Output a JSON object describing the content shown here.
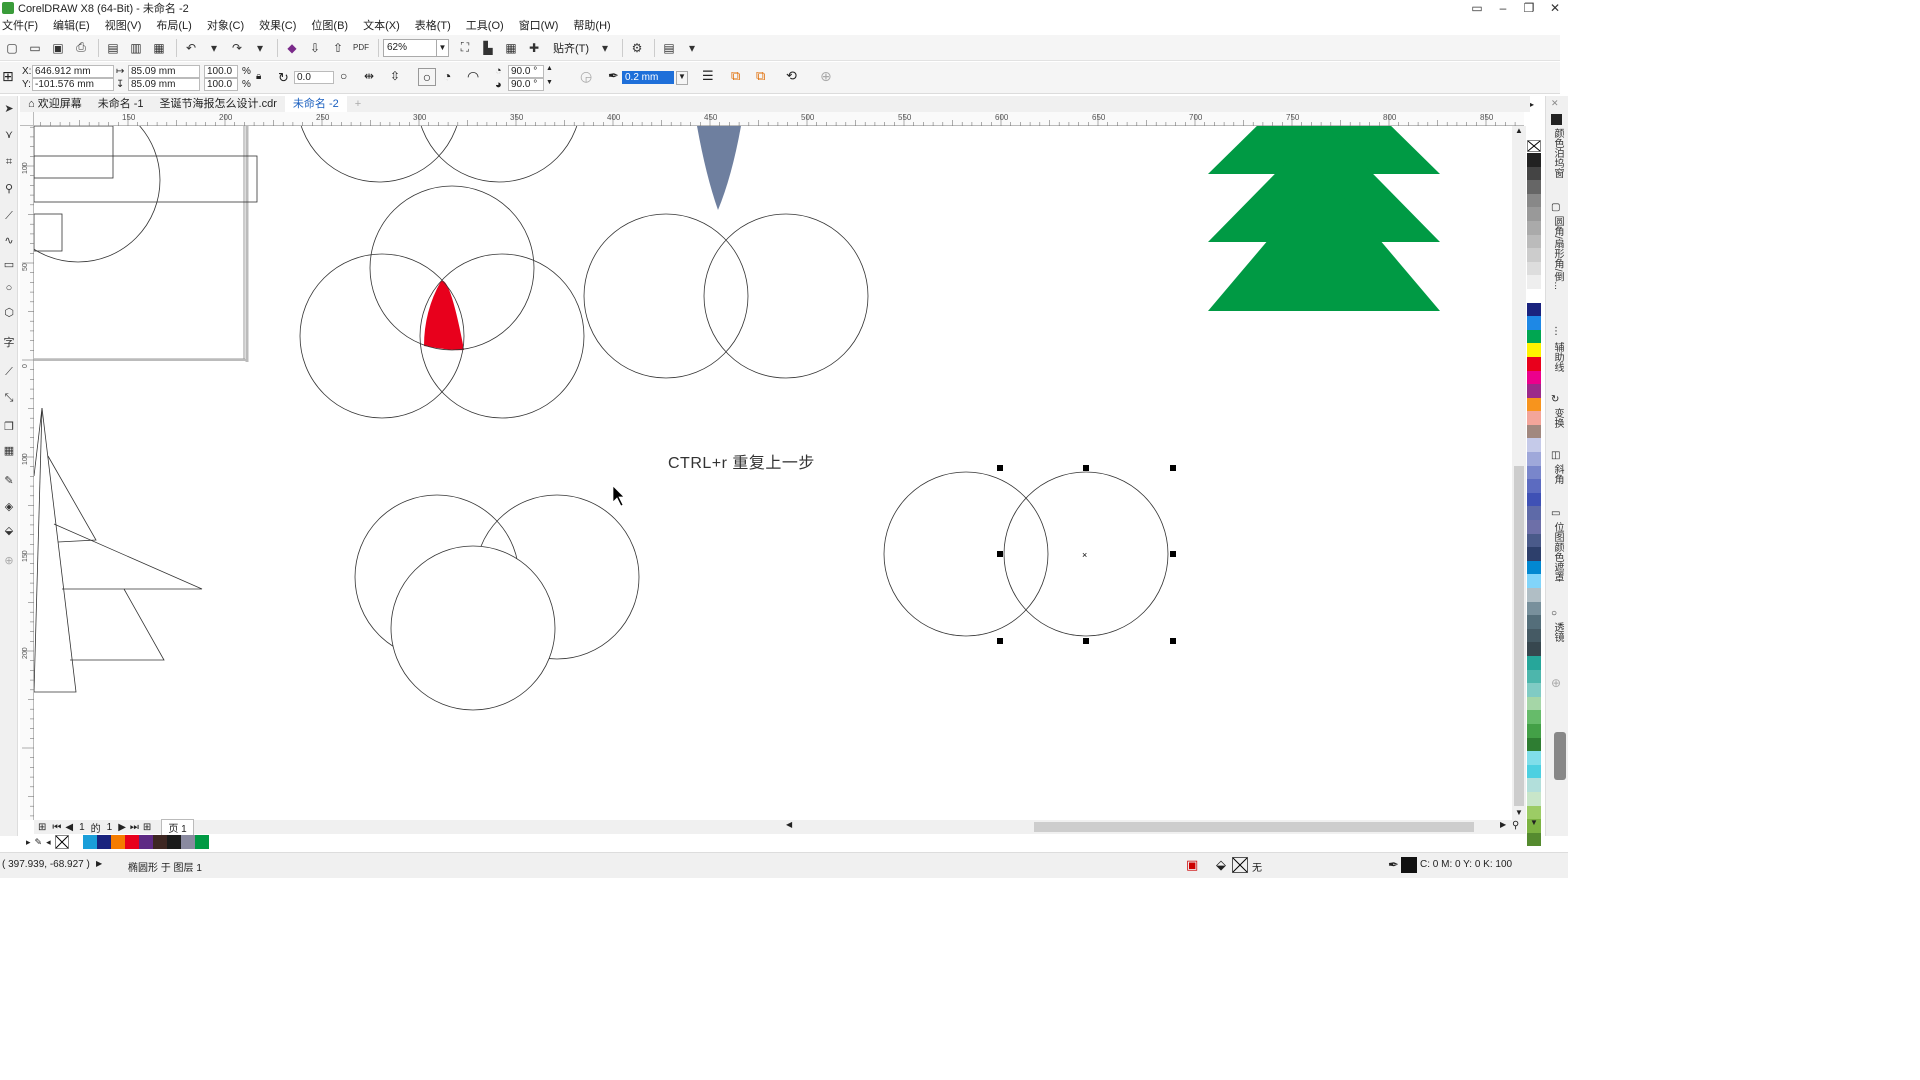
{
  "window": {
    "title": "CorelDRAW X8 (64-Bit) - 未命名 -2",
    "controls": [
      "▭",
      "–",
      "❐",
      "✕"
    ]
  },
  "menu": [
    "文件(F)",
    "编辑(E)",
    "视图(V)",
    "布局(L)",
    "对象(C)",
    "效果(C)",
    "位图(B)",
    "文本(X)",
    "表格(T)",
    "工具(O)",
    "窗口(W)",
    "帮助(H)"
  ],
  "toolbar": {
    "zoom": "62%",
    "snap": "贴齐(T)"
  },
  "propbar": {
    "x_label": "X:",
    "y_label": "Y:",
    "x": "646.912 mm",
    "y": "-101.576 mm",
    "w": "85.09 mm",
    "h": "85.09 mm",
    "sx": "100.0",
    "sy": "100.0",
    "pct": "%",
    "rotate": "0.0",
    "angle1": "90.0 °",
    "angle2": "90.0 °",
    "outline": "0.2 mm"
  },
  "tabs": [
    {
      "label": "欢迎屏幕",
      "icon": "home-icon"
    },
    {
      "label": "未命名 -1"
    },
    {
      "label": "圣诞节海报怎么设计.cdr"
    },
    {
      "label": "未命名 -2",
      "active": true
    },
    {
      "label": "+"
    }
  ],
  "ruler_h": [
    "150",
    "200",
    "250",
    "300",
    "350",
    "400",
    "450",
    "500",
    "550",
    "600",
    "650",
    "700",
    "750",
    "800",
    "850"
  ],
  "ruler_v": [
    "100",
    "50",
    "0",
    "100",
    "150",
    "200"
  ],
  "canvas": {
    "hint_text": "CTRL+r 重复上一步"
  },
  "pager": {
    "current": "1",
    "of": "的",
    "total": "1",
    "page_tab": "页 1"
  },
  "status": {
    "coords": "( 397.939, -68.927 )",
    "object_info": "椭圆形 于 图层 1",
    "fill_none": "无",
    "outline_color": "C: 0 M: 0 Y: 0 K: 100"
  },
  "dockers": [
    "颜色泊坞窗",
    "圆角/扇形角/倒...",
    "辅助线",
    "变换",
    "斜角",
    "位图颜色遮罩",
    "透镜"
  ],
  "colors": {
    "tree_green": "#009a44",
    "red_fill": "#e8001c",
    "leaf_gray": "#6e7f9f",
    "accent_blue": "#1e6fd9"
  },
  "doc_palette": [
    "#ffffff",
    "#1a9ed9",
    "#1a237e",
    "#f57c00",
    "#e8001c",
    "#5e2a84",
    "#3e2723",
    "#1b1b1b",
    "#8a8aa0",
    "#009a44"
  ],
  "side_palette": [
    "#222222",
    "#444444",
    "#666666",
    "#888888",
    "#999999",
    "#aaaaaa",
    "#bbbbbb",
    "#cccccc",
    "#dddddd",
    "#eeeeee",
    "#ffffff",
    "#1a237e",
    "#1e88e5",
    "#00a651",
    "#fff200",
    "#e8001c",
    "#ec008c",
    "#9c2a8a",
    "#f7941d",
    "#f3a59a",
    "#a1887f",
    "#c5cae9",
    "#9fa8da",
    "#7986cb",
    "#5c6bc0",
    "#3f51b5",
    "#5e6aa8",
    "#6d6fa8",
    "#4a5a8a",
    "#2d3f6b",
    "#0288d1",
    "#81d4fa",
    "#b0bec5",
    "#78909c",
    "#546e7a",
    "#455a64",
    "#37474f",
    "#26a69a",
    "#4db6ac",
    "#80cbc4",
    "#a5d6a7",
    "#66bb6a",
    "#43a047",
    "#2e7d32",
    "#80deea",
    "#4dd0e1",
    "#b2dfdb",
    "#c8e6c9",
    "#9ccc65",
    "#7cb342",
    "#558b2f"
  ]
}
